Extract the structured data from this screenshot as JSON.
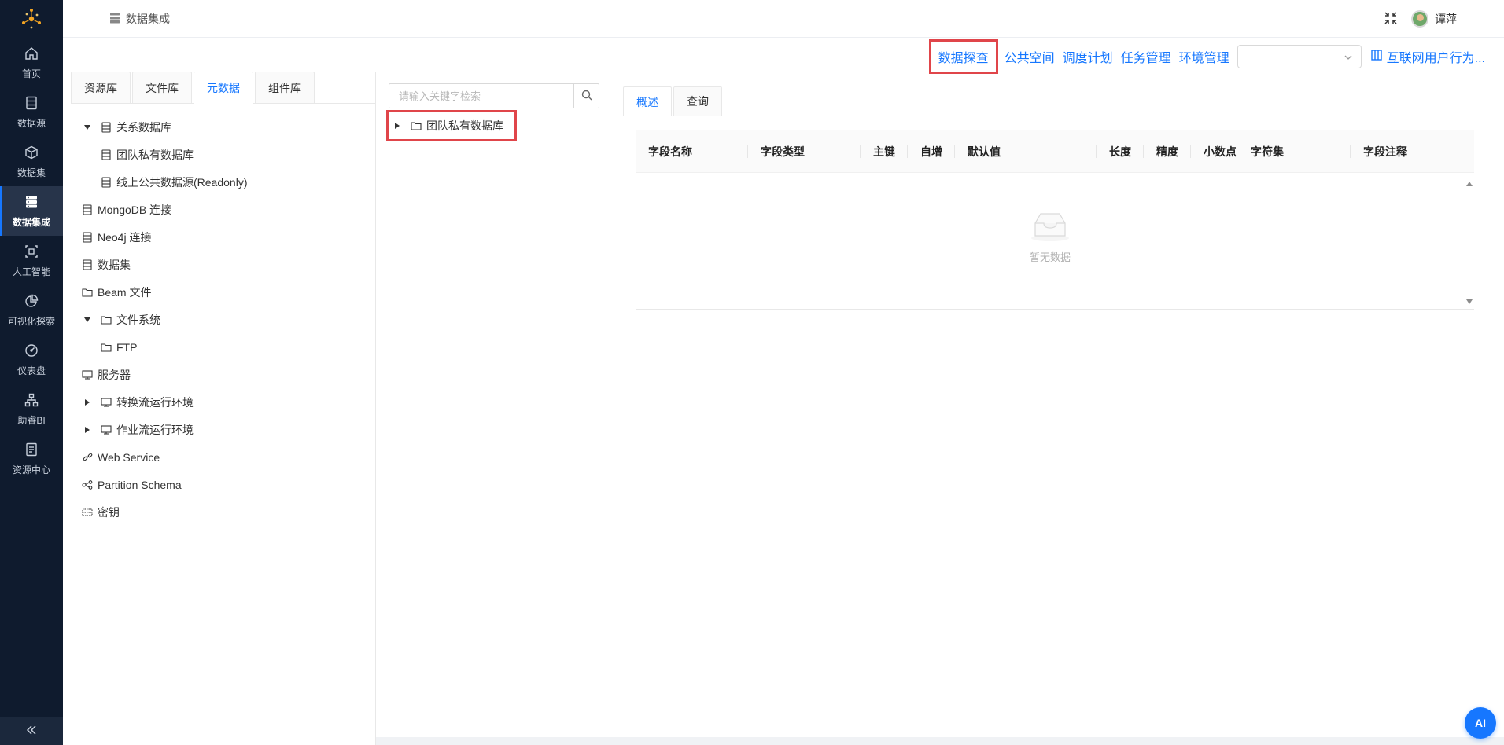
{
  "nav": {
    "items": [
      {
        "label": "首页",
        "icon": "home-icon"
      },
      {
        "label": "数据源",
        "icon": "database-icon"
      },
      {
        "label": "数据集",
        "icon": "cube-icon"
      },
      {
        "label": "数据集成",
        "icon": "server-icon"
      },
      {
        "label": "人工智能",
        "icon": "ai-icon"
      },
      {
        "label": "可视化探索",
        "icon": "pie-chart-icon"
      },
      {
        "label": "仪表盘",
        "icon": "gauge-icon"
      },
      {
        "label": "助睿BI",
        "icon": "org-chart-icon"
      },
      {
        "label": "资源中心",
        "icon": "document-icon"
      }
    ],
    "active_index": 3,
    "accent": "#1677ff"
  },
  "header": {
    "breadcrumb": "数据集成",
    "user_name": "谭萍"
  },
  "toolbar": {
    "links": [
      "数据探查",
      "公共空间",
      "调度计划",
      "任务管理",
      "环境管理"
    ],
    "select_value": "",
    "app_title": "互联网用户行为..."
  },
  "left": {
    "tabs": [
      "资源库",
      "文件库",
      "元数据",
      "组件库"
    ],
    "active_tab": 2,
    "tree": [
      {
        "label": "关系数据库",
        "caret": "expanded",
        "icon": "database-icon",
        "level": 0
      },
      {
        "label": "团队私有数据库",
        "caret": "none",
        "icon": "database-icon",
        "level": 1
      },
      {
        "label": "线上公共数据源(Readonly)",
        "caret": "none",
        "icon": "database-icon",
        "level": 1
      },
      {
        "label": "MongoDB 连接",
        "caret": "none",
        "icon": "database-icon",
        "level": -1
      },
      {
        "label": "Neo4j 连接",
        "caret": "none",
        "icon": "database-icon",
        "level": -1
      },
      {
        "label": "数据集",
        "caret": "none",
        "icon": "database-icon",
        "level": -1
      },
      {
        "label": "Beam 文件",
        "caret": "none",
        "icon": "folder-icon",
        "level": -1
      },
      {
        "label": "文件系统",
        "caret": "expanded",
        "icon": "folder-icon",
        "level": 0
      },
      {
        "label": "FTP",
        "caret": "none",
        "icon": "folder-icon",
        "level": 1
      },
      {
        "label": "服务器",
        "caret": "none",
        "icon": "monitor-icon",
        "level": -1
      },
      {
        "label": "转换流运行环境",
        "caret": "collapsed",
        "icon": "monitor-icon",
        "level": 0
      },
      {
        "label": "作业流运行环境",
        "caret": "collapsed",
        "icon": "monitor-icon",
        "level": 0
      },
      {
        "label": "Web Service",
        "caret": "none",
        "icon": "link-icon",
        "level": -1
      },
      {
        "label": "Partition Schema",
        "caret": "none",
        "icon": "share-icon",
        "level": -1
      },
      {
        "label": "密钥",
        "caret": "none",
        "icon": "key-icon",
        "level": -1
      }
    ]
  },
  "middle": {
    "search_placeholder": "请输入关键字检索",
    "node_label": "团队私有数据库"
  },
  "right": {
    "tabs": [
      "概述",
      "查询"
    ],
    "active_tab": 0,
    "columns": [
      "字段名称",
      "字段类型",
      "主键",
      "自增",
      "默认值",
      "长度",
      "精度",
      "小数点",
      "字符集",
      "字段注释"
    ],
    "empty_text": "暂无数据"
  },
  "ai_button": "AI",
  "colors": {
    "nav_bg": "#0f1b2e",
    "link": "#1677ff",
    "highlight": "#e0454a"
  }
}
